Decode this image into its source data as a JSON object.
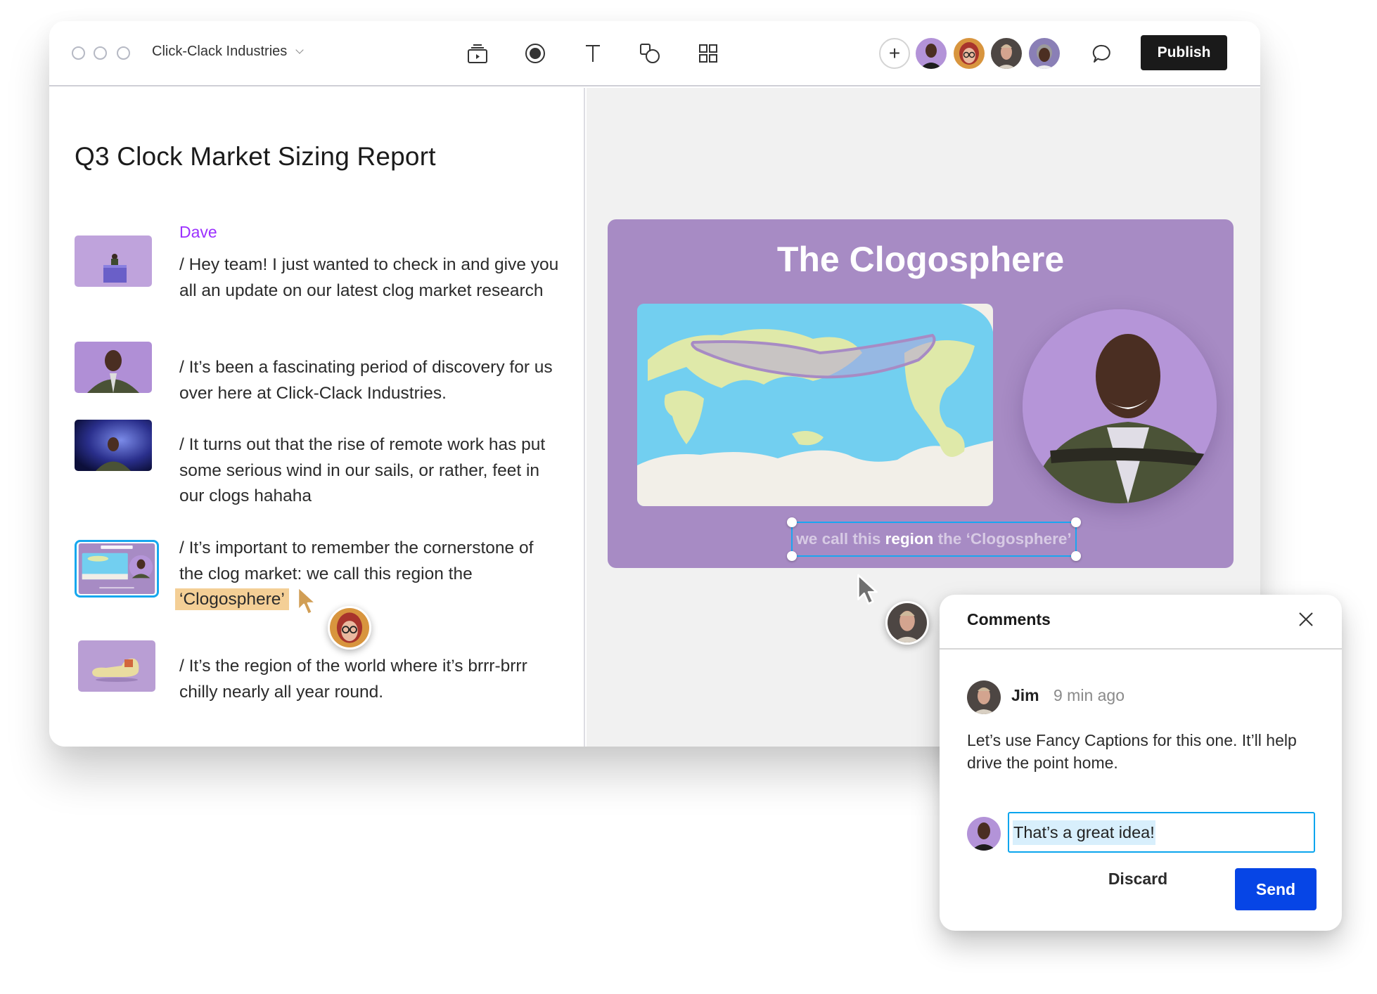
{
  "window": {
    "title": "Click-Clack Industries",
    "toolbar": {
      "tools": [
        {
          "name": "media-library-icon",
          "label": "Media"
        },
        {
          "name": "record-icon",
          "label": "Record"
        },
        {
          "name": "text-icon",
          "label": "Text"
        },
        {
          "name": "shapes-icon",
          "label": "Shapes"
        },
        {
          "name": "grid-icon",
          "label": "Templates"
        }
      ],
      "add_collaborator": "+",
      "collaborators": [
        "Dave",
        "Red-haired collaborator",
        "Jim",
        "Headset collaborator"
      ],
      "publish_label": "Publish"
    }
  },
  "document": {
    "title": "Q3 Clock Market Sizing Report",
    "speaker": "Dave",
    "paragraphs": [
      {
        "text": "/ Hey team! I just wanted to check in and give you all an update on our latest clog market research",
        "thumbnail": "presenter-at-desk"
      },
      {
        "text": "/ It’s been a fascinating period of discovery for us over here at Click-Clack Industries.",
        "thumbnail": "presenter-closeup"
      },
      {
        "text": "/ It turns out that the rise of remote work has put some serious wind in our sails, or rather, feet in our clogs hahaha",
        "thumbnail": "presenter-space"
      },
      {
        "text_before": "/ It’s important to remember the cornerstone of the clog market: we call this region the ",
        "highlight": "‘Clogosphere’",
        "thumbnail": "clogosphere-slide",
        "selected": true
      },
      {
        "text": "/ It’s the region of the world where it’s brrr-brrr chilly nearly all year round.",
        "thumbnail": "clog-shoe"
      }
    ],
    "highlight_color": "#f4cf96"
  },
  "slide": {
    "title": "The Clogosphere",
    "caption_before": "we call this ",
    "caption_bold": "region",
    "caption_after": " the ‘Clogosphere’",
    "background": "#a78bc4"
  },
  "comments": {
    "title": "Comments",
    "items": [
      {
        "author": "Jim",
        "time": "9 min ago",
        "body": "Let’s use Fancy Captions for this one. It’ll help drive the point home."
      }
    ],
    "reply_value": "That’s a great idea!",
    "discard_label": "Discard",
    "send_label": "Send",
    "accent": "#0645e6"
  }
}
